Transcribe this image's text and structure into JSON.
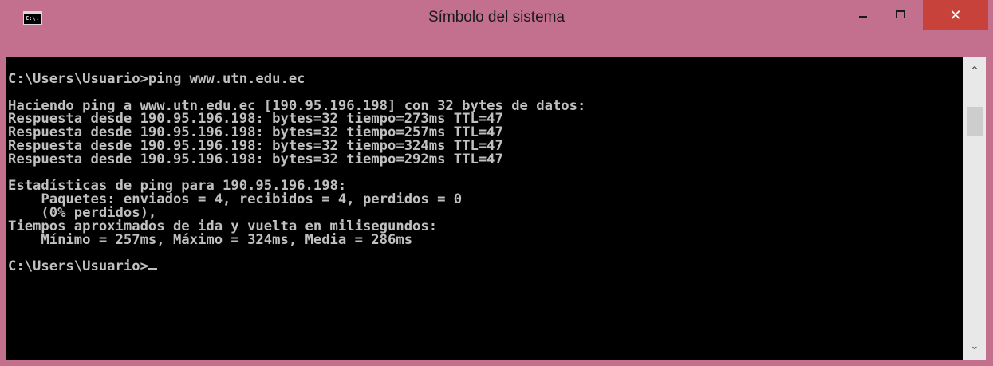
{
  "window": {
    "title": "Símbolo del sistema",
    "icon_text": "C:\\.",
    "controls": {
      "minimize": "minimize",
      "maximize": "maximize",
      "close": "✕"
    }
  },
  "console": {
    "lines": [
      "C:\\Users\\Usuario>ping www.utn.edu.ec",
      "",
      "Haciendo ping a www.utn.edu.ec [190.95.196.198] con 32 bytes de datos:",
      "Respuesta desde 190.95.196.198: bytes=32 tiempo=273ms TTL=47",
      "Respuesta desde 190.95.196.198: bytes=32 tiempo=257ms TTL=47",
      "Respuesta desde 190.95.196.198: bytes=32 tiempo=324ms TTL=47",
      "Respuesta desde 190.95.196.198: bytes=32 tiempo=292ms TTL=47",
      "",
      "Estadísticas de ping para 190.95.196.198:",
      "    Paquetes: enviados = 4, recibidos = 4, perdidos = 0",
      "    (0% perdidos),",
      "Tiempos aproximados de ida y vuelta en milisegundos:",
      "    Mínimo = 257ms, Máximo = 324ms, Media = 286ms",
      ""
    ],
    "prompt": "C:\\Users\\Usuario>"
  },
  "scrollbar": {
    "up_arrow": "^",
    "down_arrow": "⌄",
    "thumb_position_fraction": 0.0
  },
  "colors": {
    "window_frame": "#c3708e",
    "close_button": "#c7423a",
    "console_background": "#000000",
    "console_text": "#c0c0c0"
  },
  "icons": {
    "app": "console-icon",
    "minimize": "minimize-icon",
    "maximize": "maximize-icon",
    "close": "close-icon"
  }
}
